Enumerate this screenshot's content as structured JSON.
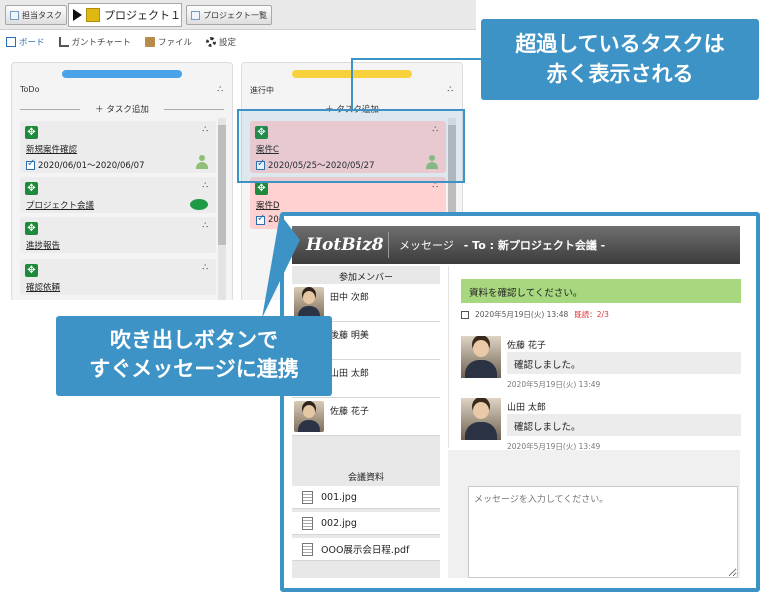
{
  "toolbar": {
    "assigned_tasks": "担当タスク",
    "project_name": "プロジェクト１",
    "project_list": "プロジェクト一覧"
  },
  "tabs": [
    "ボード",
    "ガントチャート",
    "ファイル",
    "設定"
  ],
  "columns": {
    "todo": {
      "title": "ToDo",
      "bar_color": "#4aa3e8",
      "add_label": "＋ タスク追加",
      "cards": [
        {
          "name": "新規案件確認",
          "date": "2020/06/01～2020/06/07"
        },
        {
          "name": "プロジェクト会議"
        },
        {
          "name": "進捗報告"
        },
        {
          "name": "確認依頼"
        }
      ]
    },
    "progress": {
      "title": "進行中",
      "bar_color": "#f7d23e",
      "add_label": "＋ タスク追加",
      "cards": [
        {
          "name": "案件C",
          "date": "2020/05/25～2020/05/27"
        },
        {
          "name": "案件D",
          "date": "20"
        }
      ]
    }
  },
  "callouts": {
    "overdue_line1": "超過しているタスクは",
    "overdue_line2": "赤く表示される",
    "chat_line1": "吹き出しボタンで",
    "chat_line2": "すぐメッセージに連携"
  },
  "messenger": {
    "logo": "HotBiz8",
    "label": "メッセージ",
    "to": "- To : 新プロジェクト会議 -",
    "members_title": "参加メンバー",
    "members": [
      "田中 次郎",
      "後藤 明美",
      "山田 太郎",
      "佐藤 花子"
    ],
    "files_title": "会議資料",
    "files": [
      "001.jpg",
      "002.jpg",
      "OOO展示会日程.pdf"
    ],
    "own_message": "資料を確認してください。",
    "own_time": "2020年5月19日(火) 13:48",
    "read_status": "既読：2/3",
    "replies": [
      {
        "name": "佐藤 花子",
        "text": "確認しました。",
        "time": "2020年5月19日(火) 13:49"
      },
      {
        "name": "山田 太郎",
        "text": "確認しました。",
        "time": "2020年5月19日(火) 13:49"
      }
    ],
    "input_placeholder": "メッセージを入力してください。"
  },
  "colors": {
    "accent": "#3d93c5",
    "overdue": "#ffd1d1",
    "own_bubble": "#a7d77e"
  }
}
